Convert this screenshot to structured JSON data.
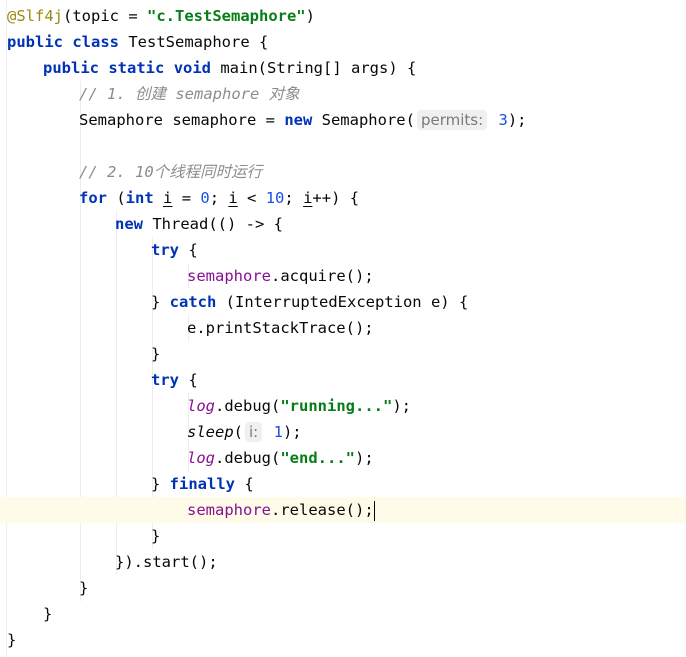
{
  "editor": {
    "language": "java",
    "colors": {
      "keyword": "#0033b3",
      "string": "#067d17",
      "annotation": "#9e880d",
      "comment": "#8c8c8c",
      "number": "#1750eb",
      "field": "#871094",
      "current_line": "#fefbe8"
    },
    "lines": [
      {
        "indent": 0,
        "tokens": [
          {
            "t": "@Slf4j",
            "c": "ann"
          },
          {
            "t": "(topic = "
          },
          {
            "t": "\"c.TestSemaphore\"",
            "c": "str"
          },
          {
            "t": ")"
          }
        ]
      },
      {
        "indent": 0,
        "tokens": [
          {
            "t": "public",
            "c": "kw"
          },
          {
            "t": " "
          },
          {
            "t": "class",
            "c": "kw"
          },
          {
            "t": " TestSemaphore {"
          }
        ]
      },
      {
        "indent": 1,
        "tokens": [
          {
            "t": "public",
            "c": "kw"
          },
          {
            "t": " "
          },
          {
            "t": "static",
            "c": "kw"
          },
          {
            "t": " "
          },
          {
            "t": "void",
            "c": "kw"
          },
          {
            "t": " main(String[] args) {"
          }
        ]
      },
      {
        "indent": 2,
        "tokens": [
          {
            "t": "// 1. 创建 semaphore 对象",
            "c": "cmt"
          }
        ]
      },
      {
        "indent": 2,
        "tokens": [
          {
            "t": "Semaphore semaphore = "
          },
          {
            "t": "new",
            "c": "kw"
          },
          {
            "t": " Semaphore("
          },
          {
            "t": "permits:",
            "c": "hint"
          },
          {
            "t": " "
          },
          {
            "t": "3",
            "c": "num"
          },
          {
            "t": ");"
          }
        ]
      },
      {
        "indent": 0,
        "tokens": []
      },
      {
        "indent": 2,
        "tokens": [
          {
            "t": "// 2. 10个线程同时运行",
            "c": "cmt"
          }
        ]
      },
      {
        "indent": 2,
        "tokens": [
          {
            "t": "for",
            "c": "kw"
          },
          {
            "t": " ("
          },
          {
            "t": "int",
            "c": "kw"
          },
          {
            "t": " "
          },
          {
            "t": "i",
            "c": "ul"
          },
          {
            "t": " = "
          },
          {
            "t": "0",
            "c": "num"
          },
          {
            "t": "; "
          },
          {
            "t": "i",
            "c": "ul"
          },
          {
            "t": " < "
          },
          {
            "t": "10",
            "c": "num"
          },
          {
            "t": "; "
          },
          {
            "t": "i",
            "c": "ul"
          },
          {
            "t": "++) {"
          }
        ]
      },
      {
        "indent": 3,
        "tokens": [
          {
            "t": "new",
            "c": "kw"
          },
          {
            "t": " Thread(() -> {"
          }
        ]
      },
      {
        "indent": 4,
        "tokens": [
          {
            "t": "try",
            "c": "kw"
          },
          {
            "t": " {"
          }
        ]
      },
      {
        "indent": 5,
        "tokens": [
          {
            "t": "semaphore",
            "c": "fld"
          },
          {
            "t": ".acquire();"
          }
        ]
      },
      {
        "indent": 4,
        "tokens": [
          {
            "t": "} "
          },
          {
            "t": "catch",
            "c": "kw"
          },
          {
            "t": " (InterruptedException e) {"
          }
        ]
      },
      {
        "indent": 5,
        "tokens": [
          {
            "t": "e.printStackTrace();"
          }
        ]
      },
      {
        "indent": 4,
        "tokens": [
          {
            "t": "}"
          }
        ]
      },
      {
        "indent": 4,
        "tokens": [
          {
            "t": "try",
            "c": "kw"
          },
          {
            "t": " {"
          }
        ]
      },
      {
        "indent": 5,
        "tokens": [
          {
            "t": "log",
            "c": "sfld"
          },
          {
            "t": ".debug("
          },
          {
            "t": "\"running...\"",
            "c": "str"
          },
          {
            "t": ");"
          }
        ]
      },
      {
        "indent": 5,
        "tokens": [
          {
            "t": "sleep",
            "c": "smeth"
          },
          {
            "t": "("
          },
          {
            "t": "i:",
            "c": "hint"
          },
          {
            "t": " "
          },
          {
            "t": "1",
            "c": "num"
          },
          {
            "t": ");"
          }
        ]
      },
      {
        "indent": 5,
        "tokens": [
          {
            "t": "log",
            "c": "sfld"
          },
          {
            "t": ".debug("
          },
          {
            "t": "\"end...\"",
            "c": "str"
          },
          {
            "t": ");"
          }
        ]
      },
      {
        "indent": 4,
        "tokens": [
          {
            "t": "} "
          },
          {
            "t": "finally",
            "c": "kw"
          },
          {
            "t": " {"
          }
        ]
      },
      {
        "indent": 5,
        "current": true,
        "tokens": [
          {
            "t": "semaphore",
            "c": "fld"
          },
          {
            "t": ".release();"
          },
          {
            "t": "",
            "c": "caret"
          }
        ]
      },
      {
        "indent": 4,
        "tokens": [
          {
            "t": "}"
          }
        ]
      },
      {
        "indent": 3,
        "tokens": [
          {
            "t": "}).start();"
          }
        ]
      },
      {
        "indent": 2,
        "tokens": [
          {
            "t": "}"
          }
        ]
      },
      {
        "indent": 1,
        "tokens": [
          {
            "t": "}"
          }
        ]
      },
      {
        "indent": 0,
        "tokens": [
          {
            "t": "}"
          }
        ]
      }
    ]
  }
}
